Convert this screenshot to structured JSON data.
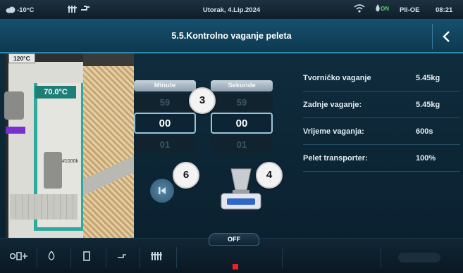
{
  "statusbar": {
    "outside_temp": "-10°C",
    "date": "Utorak, 4.Lip.2024",
    "mode_on": "ON",
    "day": "PII-OE",
    "time": "08:21"
  },
  "header": {
    "title": "5.5.Kontrolno vaganje peleta"
  },
  "diagram": {
    "top_temp": "120°C",
    "boiler_temp": "70.0°C",
    "fan_label": "#1000k"
  },
  "picker": {
    "minutes": {
      "label": "Minute",
      "prev": "59",
      "current": "00",
      "next": "01"
    },
    "seconds": {
      "label": "Sekunde",
      "prev": "59",
      "current": "00",
      "next": "01"
    }
  },
  "callouts": {
    "picker_num": "3",
    "scale_num": "4",
    "reset_num": "6"
  },
  "info": [
    {
      "label": "Tvorničko vaganje",
      "value": "5.45kg"
    },
    {
      "label": "Zadnje vaganje:",
      "value": "5.45kg"
    },
    {
      "label": "Vrijeme vaganja:",
      "value": "600s"
    },
    {
      "label": "Pelet transporter:",
      "value": "100%"
    }
  ],
  "bottombar": {
    "off_label": "OFF"
  },
  "colors": {
    "accent": "#2d86ad",
    "teal": "#2fa99d",
    "status_on": "#4fd36a",
    "alert": "#e22222"
  }
}
